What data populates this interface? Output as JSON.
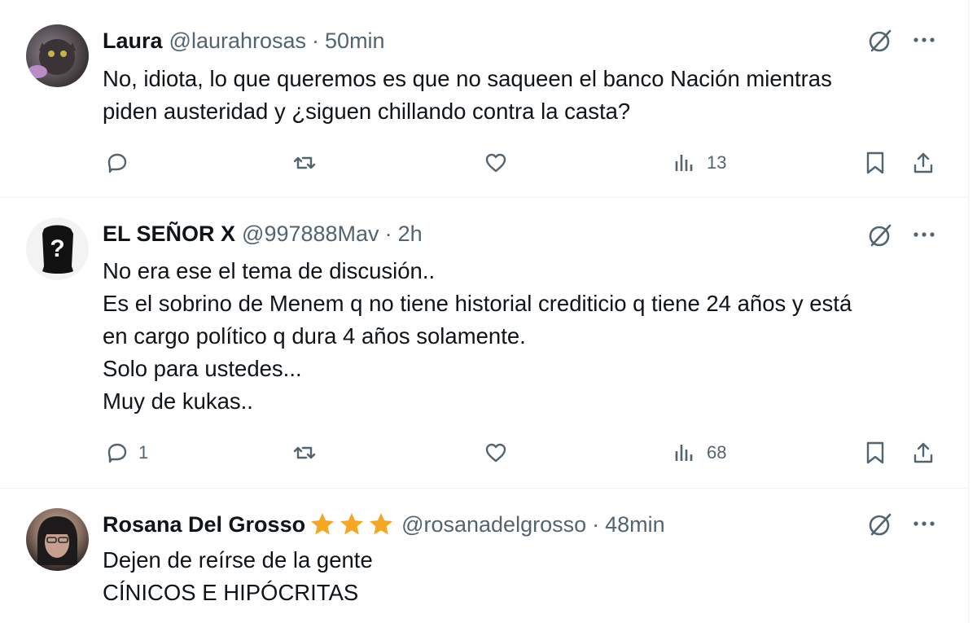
{
  "colors": {
    "text": "#0f1419",
    "muted": "#536471",
    "divider": "#eff3f4",
    "star": "#f5a623"
  },
  "tweets": [
    {
      "name": "Laura",
      "handle": "@laurahrosas",
      "separator": "·",
      "time": "50min",
      "lines": [
        "No, idiota, lo que queremos es que no saqueen el banco Nación mientras",
        "piden austeridad y ¿siguen chillando contra la casta?"
      ],
      "actions": {
        "replies": "",
        "views": "13"
      }
    },
    {
      "name": "EL SEÑOR X",
      "handle": "@997888Mav",
      "separator": "·",
      "time": "2h",
      "lines": [
        "No era ese el tema de discusión..",
        "Es el sobrino de Menem q no tiene historial crediticio q tiene 24 años y está",
        "en cargo político q dura 4 años solamente.",
        "Solo para ustedes...",
        "Muy de kukas.."
      ],
      "actions": {
        "replies": "1",
        "views": "68"
      }
    },
    {
      "name": "Rosana Del Grosso",
      "name_decoration": "star-emoji x3",
      "handle": "@rosanadelgrosso",
      "separator": "·",
      "time": "48min",
      "lines": [
        "Dejen de reírse de la gente",
        "CÍNICOS E HIPÓCRITAS"
      ]
    }
  ]
}
